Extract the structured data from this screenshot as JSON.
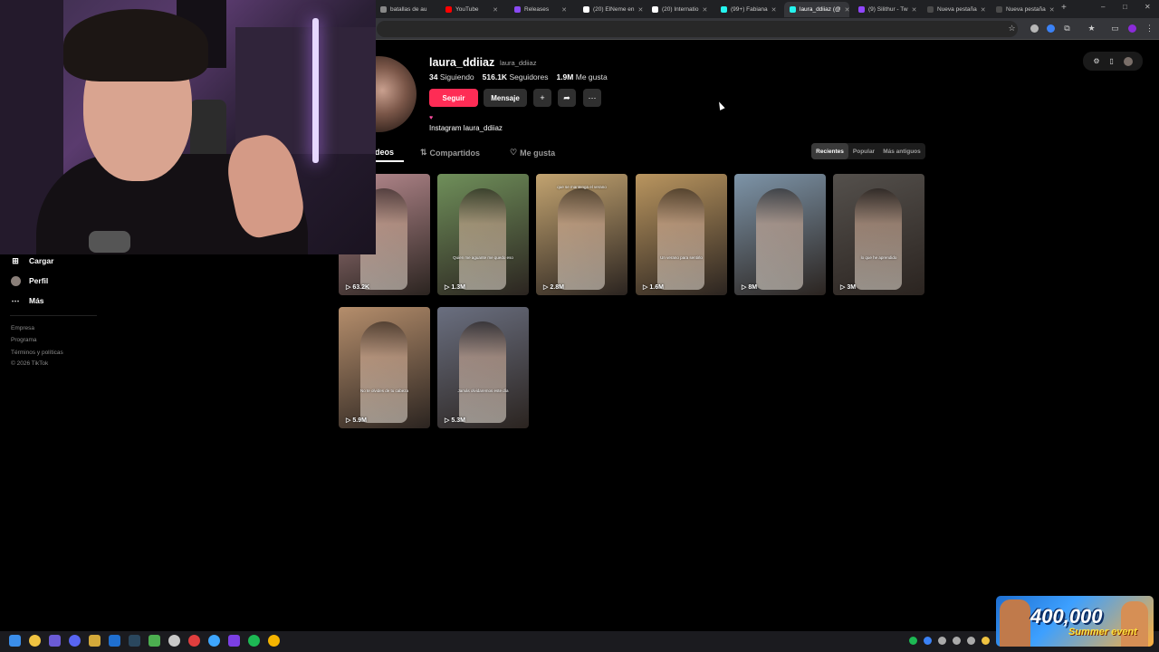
{
  "browser": {
    "tabs": [
      {
        "label": "batallas de au",
        "color": "#888888"
      },
      {
        "label": "YouTube",
        "color": "#ff0000"
      },
      {
        "label": "Releases",
        "color": "#8a4af3"
      },
      {
        "label": "(20) ElNeme en",
        "color": "#ffffff"
      },
      {
        "label": "(20) Internatio",
        "color": "#ffffff"
      },
      {
        "label": "(99+) Fabiana",
        "color": "#25f4ee"
      },
      {
        "label": "laura_ddiiaz (@",
        "color": "#25f4ee"
      },
      {
        "label": "(9) Silithur - Tw",
        "color": "#9146ff"
      },
      {
        "label": "Nueva pestaña",
        "color": "#4a4a4a"
      },
      {
        "label": "Nueva pestaña",
        "color": "#4a4a4a"
      }
    ],
    "active_tab_index": 6
  },
  "nav": {
    "items": [
      {
        "label": "Cargar",
        "icon": "upload-icon"
      },
      {
        "label": "Perfil",
        "icon": "avatar"
      },
      {
        "label": "Más",
        "icon": "more-icon"
      }
    ],
    "footer": [
      "Empresa",
      "Programa",
      "Términos y políticas",
      "© 2026 TikTok"
    ]
  },
  "profile": {
    "username": "laura_ddiiaz",
    "nickname": "laura_ddiiaz",
    "following_count": "34",
    "following_label": "Siguiendo",
    "followers_count": "516.1K",
    "followers_label": "Seguidores",
    "likes_count": "1.9M",
    "likes_label": "Me gusta",
    "follow_label": "Seguir",
    "message_label": "Mensaje",
    "bio_heart": "♥",
    "bio": "Instagram laura_ddiiaz"
  },
  "tabs": {
    "videos": "deos",
    "shared": "Compartidos",
    "liked": "Me gusta"
  },
  "sort": {
    "recent": "Recientes",
    "popular": "Popular",
    "oldest": "Más antiguos",
    "active": "recent"
  },
  "videos": [
    {
      "views": "63.2K",
      "caption": "",
      "bg": "#b78a8f"
    },
    {
      "views": "1.3M",
      "caption": "Quien me aguante me quedo eso",
      "bg": "#6f8f5a"
    },
    {
      "views": "2.8M",
      "caption": "que se mantenga el verano",
      "bg": "#c2a370"
    },
    {
      "views": "1.6M",
      "caption": "Un verano para sentirlo",
      "bg": "#b9955f"
    },
    {
      "views": "8M",
      "caption": "",
      "bg": "#7d94a8"
    },
    {
      "views": "3M",
      "caption": "lo que he aprendido",
      "bg": "#54504c"
    },
    {
      "views": "5.9M",
      "caption": "No te olvides de tu cabeza",
      "bg": "#b58e6c"
    },
    {
      "views": "5.3M",
      "caption": "Jamás olvidaremos este día",
      "bg": "#6a6f80"
    }
  ],
  "overlay": {
    "event_number": "400,000",
    "event_text": "Summer event"
  },
  "colors": {
    "accent": "#fe2c55",
    "background": "#000000"
  }
}
